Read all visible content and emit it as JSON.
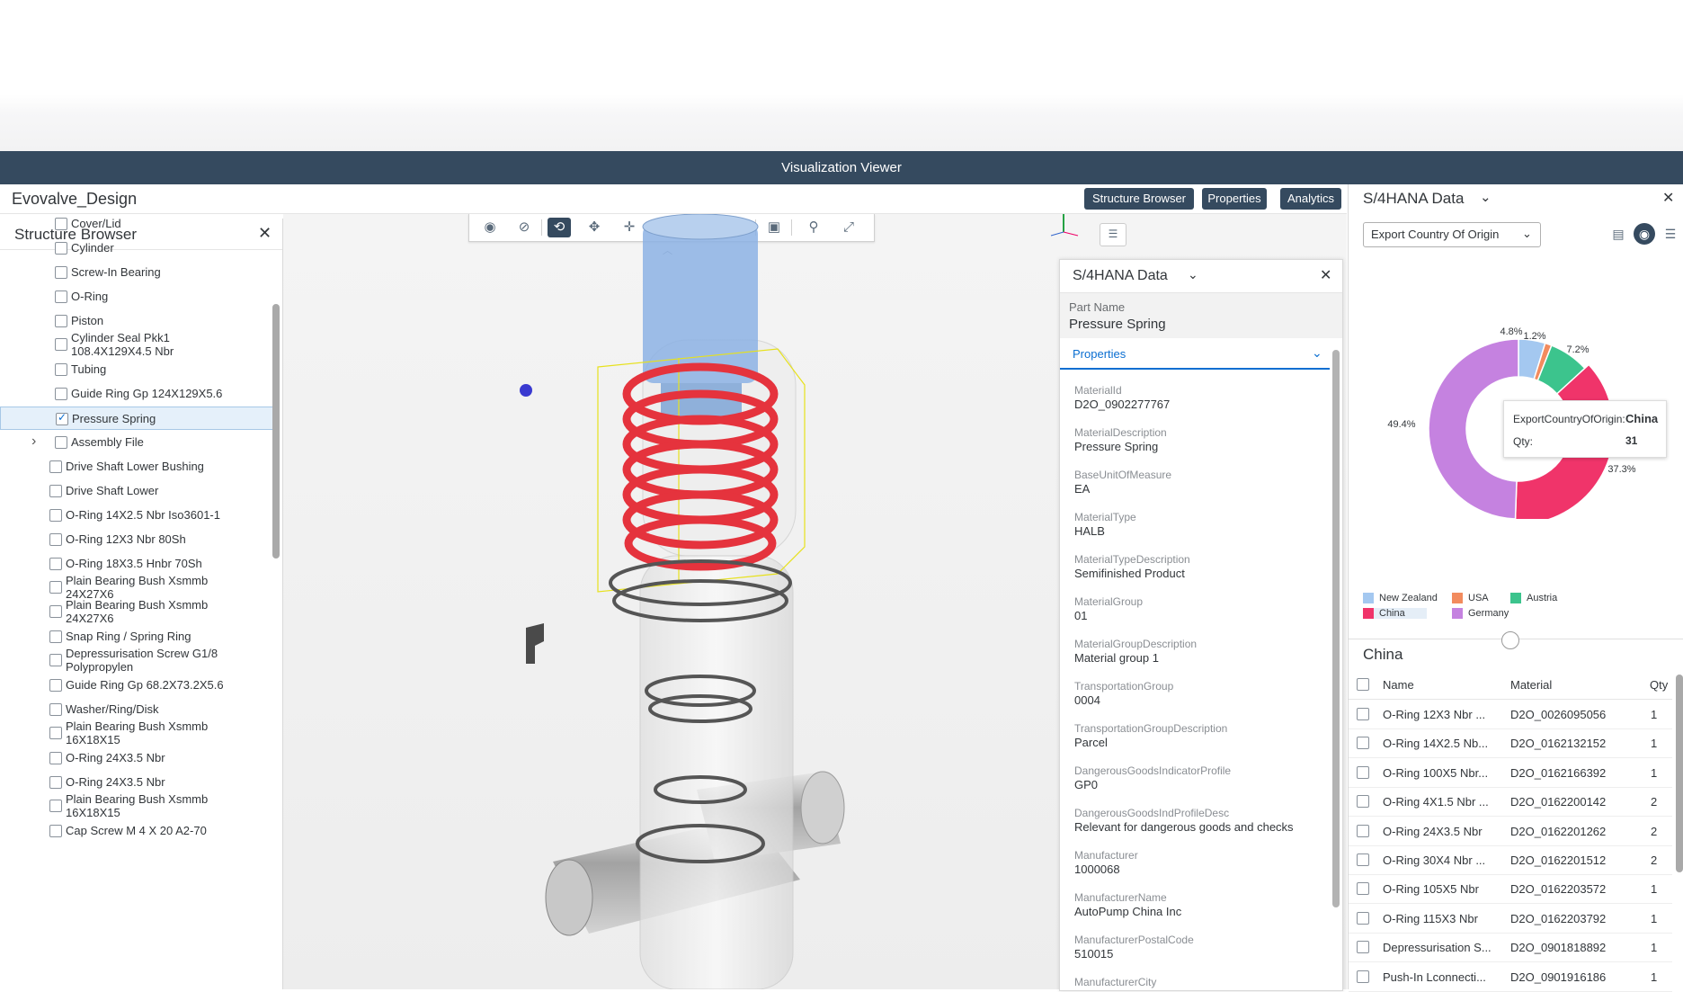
{
  "window": {
    "title": "Visualization Viewer"
  },
  "app": {
    "title": "Evovalve_Design"
  },
  "top_buttons": [
    "Structure Browser",
    "Properties",
    "Analytics"
  ],
  "structure_browser": {
    "title": "Structure Browser",
    "items": [
      {
        "label": "Cover/Lid",
        "checked": false
      },
      {
        "label": "Cylinder",
        "checked": false
      },
      {
        "label": "Screw-In Bearing",
        "checked": false
      },
      {
        "label": "O-Ring",
        "checked": false
      },
      {
        "label": "Piston",
        "checked": false
      },
      {
        "label": "Cylinder Seal Pkk1",
        "label2": "108.4X129X4.5 Nbr",
        "checked": false
      },
      {
        "label": "Tubing",
        "checked": false
      },
      {
        "label": "Guide Ring Gp 124X129X5.6",
        "checked": false
      },
      {
        "label": "Pressure Spring",
        "checked": true,
        "selected": true
      },
      {
        "label": "Assembly File",
        "checked": false,
        "expandable": true
      },
      {
        "label": "Drive Shaft Lower Bushing",
        "checked": false
      },
      {
        "label": "Drive Shaft Lower",
        "checked": false
      },
      {
        "label": "O-Ring 14X2.5 Nbr Iso3601-1",
        "checked": false
      },
      {
        "label": "O-Ring 12X3 Nbr 80Sh",
        "checked": false
      },
      {
        "label": "O-Ring 18X3.5 Hnbr 70Sh",
        "checked": false
      },
      {
        "label": "Plain Bearing Bush Xsmmb",
        "label2": "24X27X6",
        "checked": false
      },
      {
        "label": "Plain Bearing Bush Xsmmb",
        "label2": "24X27X6",
        "checked": false
      },
      {
        "label": "Snap Ring / Spring Ring",
        "checked": false
      },
      {
        "label": "Depressurisation Screw G1/8",
        "label2": "Polypropylen",
        "checked": false
      },
      {
        "label": "Guide Ring Gp 68.2X73.2X5.6",
        "checked": false
      },
      {
        "label": "Washer/Ring/Disk",
        "checked": false
      },
      {
        "label": "Plain Bearing Bush Xsmmb",
        "label2": "16X18X15",
        "checked": false
      },
      {
        "label": "O-Ring 24X3.5 Nbr",
        "checked": false
      },
      {
        "label": "O-Ring 24X3.5 Nbr",
        "checked": false
      },
      {
        "label": "Plain Bearing Bush Xsmmb",
        "label2": "16X18X15",
        "checked": false
      },
      {
        "label": "Cap Screw M 4 X 20 A2-70",
        "checked": false
      }
    ]
  },
  "toolbar": {
    "icons": [
      "eye-icon",
      "hide-icon",
      "rotate-icon",
      "turntable-icon",
      "pan-icon",
      "zoom-icon",
      "fit-icon",
      "rect-select-icon",
      "isolate-icon",
      "link-icon",
      "fullscreen-icon"
    ]
  },
  "axis_label": "Y",
  "floating_panel": {
    "title": "S/4HANA Data",
    "part_name_label": "Part Name",
    "part_name_value": "Pressure Spring",
    "properties_label": "Properties",
    "fields": [
      {
        "key": "MaterialId",
        "value": "D2O_0902277767"
      },
      {
        "key": "MaterialDescription",
        "value": "Pressure Spring"
      },
      {
        "key": "BaseUnitOfMeasure",
        "value": "EA"
      },
      {
        "key": "MaterialType",
        "value": "HALB"
      },
      {
        "key": "MaterialTypeDescription",
        "value": "Semifinished Product"
      },
      {
        "key": "MaterialGroup",
        "value": "01"
      },
      {
        "key": "MaterialGroupDescription",
        "value": "Material group 1"
      },
      {
        "key": "TransportationGroup",
        "value": "0004"
      },
      {
        "key": "TransportationGroupDescription",
        "value": "Parcel"
      },
      {
        "key": "DangerousGoodsIndicatorProfile",
        "value": "GP0"
      },
      {
        "key": "DangerousGoodsIndProfileDesc",
        "value": "Relevant for dangerous goods and checks"
      },
      {
        "key": "Manufacturer",
        "value": "1000068"
      },
      {
        "key": "ManufacturerName",
        "value": "AutoPump China Inc"
      },
      {
        "key": "ManufacturerPostalCode",
        "value": "510015"
      },
      {
        "key": "ManufacturerCity",
        "value": ""
      }
    ]
  },
  "right_panel": {
    "title": "S/4HANA Data",
    "select_value": "Export Country Of Origin",
    "tooltip": {
      "label": "ExportCountryOfOrigin:",
      "value": "China",
      "qty_label": "Qty:",
      "qty_value": "31"
    },
    "table_title": "China",
    "table_headers": [
      "Name",
      "Material",
      "Qty"
    ],
    "rows": [
      {
        "name": "O-Ring 12X3 Nbr ...",
        "material": "D2O_0026095056",
        "qty": "1"
      },
      {
        "name": "O-Ring 14X2.5 Nb...",
        "material": "D2O_0162132152",
        "qty": "1"
      },
      {
        "name": "O-Ring 100X5 Nbr...",
        "material": "D2O_0162166392",
        "qty": "1"
      },
      {
        "name": "O-Ring 4X1.5 Nbr ...",
        "material": "D2O_0162200142",
        "qty": "2"
      },
      {
        "name": "O-Ring 24X3.5 Nbr",
        "material": "D2O_0162201262",
        "qty": "2"
      },
      {
        "name": "O-Ring 30X4 Nbr ...",
        "material": "D2O_0162201512",
        "qty": "2"
      },
      {
        "name": "O-Ring 105X5 Nbr",
        "material": "D2O_0162203572",
        "qty": "1"
      },
      {
        "name": "O-Ring 115X3 Nbr",
        "material": "D2O_0162203792",
        "qty": "1"
      },
      {
        "name": "Depressurisation S...",
        "material": "D2O_0901818892",
        "qty": "1"
      },
      {
        "name": "Push-In Lconnecti...",
        "material": "D2O_0901916186",
        "qty": "1"
      }
    ]
  },
  "chart_data": {
    "type": "pie",
    "title": "",
    "categories": [
      "New Zealand",
      "USA",
      "Austria",
      "China",
      "Germany"
    ],
    "values": [
      4.8,
      1.2,
      7.2,
      37.3,
      49.4
    ],
    "value_labels": [
      "4.8%",
      "1.2%",
      "7.2%",
      "37.3%",
      "49.4%"
    ],
    "colors": [
      "#a4c8f0",
      "#f28b5e",
      "#3cc48d",
      "#f0346a",
      "#c582e0"
    ],
    "legend": "bottom",
    "highlighted": "China"
  }
}
